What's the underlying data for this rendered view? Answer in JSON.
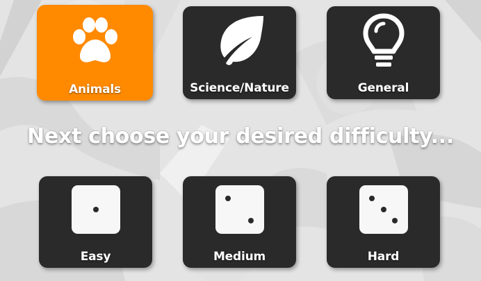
{
  "colors": {
    "card_bg": "#2a2a2a",
    "selected_bg": "#ff8a00",
    "text": "#ffffff",
    "die_face": "#f7f7f7"
  },
  "categories": [
    {
      "label": "Animals",
      "icon": "paw-icon",
      "selected": true
    },
    {
      "label": "Science/Nature",
      "icon": "leaf-icon",
      "selected": false
    },
    {
      "label": "General",
      "icon": "lightbulb-icon",
      "selected": false
    }
  ],
  "heading": "Next choose your desired difficulty...",
  "difficulties": [
    {
      "label": "Easy",
      "icon": "die-one-icon",
      "pips": 1
    },
    {
      "label": "Medium",
      "icon": "die-two-icon",
      "pips": 2
    },
    {
      "label": "Hard",
      "icon": "die-three-icon",
      "pips": 3
    }
  ]
}
